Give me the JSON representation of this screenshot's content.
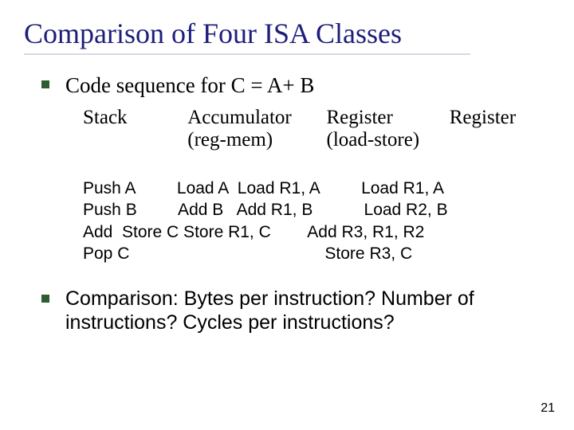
{
  "title": "Comparison of Four ISA Classes",
  "bullets": {
    "b1": "Code sequence for C = A+ B",
    "b2": "Comparison: Bytes per instruction? Number of instructions? Cycles per instructions?"
  },
  "headers": {
    "c1": "Stack",
    "c2": "Accumulator",
    "c3a": "Register",
    "c3b": "(reg-mem)",
    "c4a": "Register",
    "c4b": "(load-store)"
  },
  "code": {
    "l1": "Push A         Load A  Load R1, A         Load R1, A",
    "l2": "Push B         Add B   Add R1, B           Load R2, B",
    "l3": "Add  Store C Store R1, C        Add R3, R1, R2",
    "l4": "Pop C                                          Store R3, C"
  },
  "page": "21"
}
